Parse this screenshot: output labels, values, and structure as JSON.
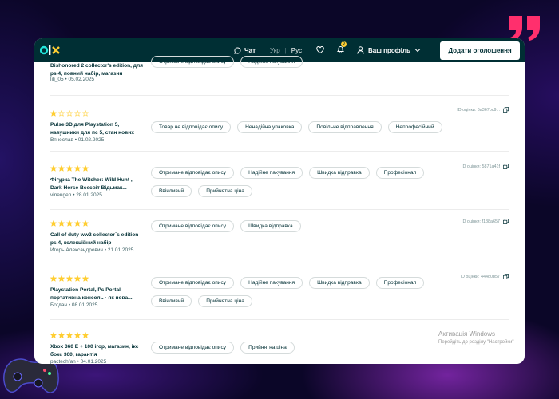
{
  "header": {
    "logo": "OLX",
    "chat_label": "Чат",
    "lang_ukr": "Укр",
    "lang_sep": "|",
    "lang_rus": "Рус",
    "notification_count": "0",
    "profile_label": "Ваш профіль",
    "add_button_label": "Додати оголошення"
  },
  "reviews": [
    {
      "title": "Dishonored 2 collector's edition, для ps 4, повний набір, магазин",
      "meta": "lili_05 • 05.02.2025",
      "stars": null,
      "review_id": null,
      "tags": [
        "Отримане відповідає опису",
        "Надійне пакування"
      ]
    },
    {
      "title": "Pulse 3D для Playstation 5, навушники для пс 5, стан нових",
      "meta": "Вячеслав • 01.02.2025",
      "stars": 1,
      "review_id": "ID оцінки: 6a367bc9...",
      "tags": [
        "Товар не відповідає опису",
        "Ненадійна упаковка",
        "Повільне відправлення",
        "Непрофесійний"
      ]
    },
    {
      "title": "Фігурка The Witcher: Wild Hunt , Dark Horse Всесвіт Відьмак...",
      "meta": "vineugen • 28.01.2025",
      "stars": 5,
      "review_id": "ID оцінки: 5871a41f",
      "tags": [
        "Отримане відповідає опису",
        "Надійне пакування",
        "Швидка відправка",
        "Професіонал",
        "Ввічливий",
        "Прийнятна ціна"
      ]
    },
    {
      "title": "Call of duty ww2 collector`s edition ps 4, колекційний набір",
      "meta": "Игорь Александрович • 21.01.2025",
      "stars": 5,
      "review_id": "ID оцінки: f188a657",
      "tags": [
        "Отримане відповідає опису",
        "Швидка відправка"
      ]
    },
    {
      "title": "Playstation Portal, Ps Portal портативна консоль · як нова...",
      "meta": "Богдан • 08.01.2025",
      "stars": 5,
      "review_id": "ID оцінки: 444d0b57",
      "tags": [
        "Отримане відповідає опису",
        "Надійне пакування",
        "Швидка відправка",
        "Професіонал",
        "Ввічливий",
        "Прийнятна ціна"
      ]
    },
    {
      "title": "Xbox 360 E + 100 ігор, магазин, ікс бокс 360, гарантія",
      "meta": "pactechfan • 04.01.2025",
      "stars": 5,
      "review_id": null,
      "tags": [
        "Отримане відповідає опису",
        "Прийнятна ціна"
      ]
    }
  ],
  "windows_activation": {
    "line1": "Активація Windows",
    "line2": "Перейдіть до розділу \"Настройки\""
  },
  "colors": {
    "brand_dark": "#002f34",
    "star": "#ffce32",
    "accent_teal": "#23e5db"
  }
}
